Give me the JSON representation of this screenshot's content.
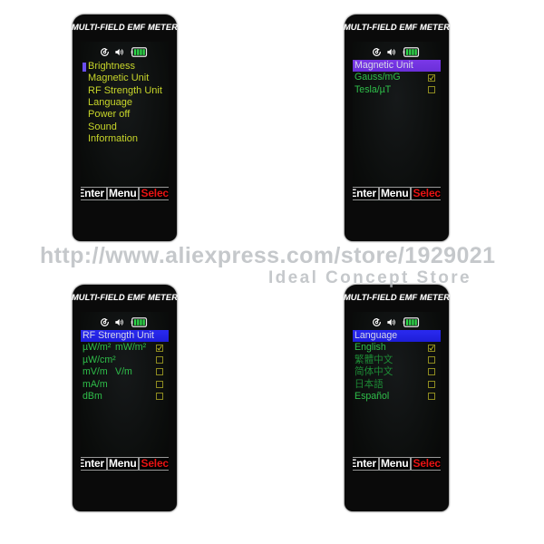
{
  "product": {
    "brand_title": "MULTI-FIELD EMF METER"
  },
  "status_bar": {
    "icons": [
      "timer-icon",
      "speaker-icon",
      "battery-icon"
    ],
    "battery_bars": 4,
    "battery_color": "#2fd64a"
  },
  "softkeys": {
    "enter": "Enter",
    "menu": "Menu",
    "select": "Select",
    "enter_color": "#ffffff",
    "menu_color": "#ffffff",
    "select_color": "#e81313"
  },
  "colors": {
    "menu_text": "#c8d62a",
    "option_text": "#2fbf4a",
    "header_violet": "#7b38e8",
    "header_blue": "#2a2af0",
    "cursor": "#6a4ef0",
    "checkbox_border": "#8e8b20",
    "device_body": "#0a0a0a",
    "screen_bg": "#0c0f0c"
  },
  "panels": [
    {
      "id": "main-menu",
      "type": "menu",
      "selected_index": 0,
      "items": [
        {
          "label": "Brightness"
        },
        {
          "label": "Magnetic Unit"
        },
        {
          "label": "RF Strength Unit"
        },
        {
          "label": "Language"
        },
        {
          "label": "Power off"
        },
        {
          "label": "Sound"
        },
        {
          "label": "Information"
        }
      ]
    },
    {
      "id": "magnetic-unit",
      "type": "options",
      "header": "Magnetic Unit",
      "header_style": "violet",
      "options": [
        {
          "label": "Gauss/mG",
          "alt": "",
          "checked": true
        },
        {
          "label": "Tesla/µT",
          "alt": "",
          "checked": false
        }
      ]
    },
    {
      "id": "rf-strength-unit",
      "type": "options",
      "header": "RF Strength Unit",
      "header_style": "blue",
      "options": [
        {
          "label": "µW/m²",
          "alt": "mW/m²",
          "checked": true
        },
        {
          "label": "µW/cm²",
          "alt": "",
          "checked": false
        },
        {
          "label": "mV/m",
          "alt": "V/m",
          "checked": false
        },
        {
          "label": "mA/m",
          "alt": "",
          "checked": false
        },
        {
          "label": "dBm",
          "alt": "",
          "checked": false
        }
      ]
    },
    {
      "id": "language",
      "type": "options",
      "header": "Language",
      "header_style": "blue",
      "options": [
        {
          "label": "English",
          "alt": "",
          "checked": true
        },
        {
          "label": "繁體中文",
          "alt": "",
          "checked": false
        },
        {
          "label": "简体中文",
          "alt": "",
          "checked": false
        },
        {
          "label": "日本語",
          "alt": "",
          "checked": false
        },
        {
          "label": "Español",
          "alt": "",
          "checked": false
        }
      ]
    }
  ],
  "watermark": {
    "line1": "http://www.aliexpress.com/store/1929021",
    "line2": "Ideal Concept Store"
  }
}
